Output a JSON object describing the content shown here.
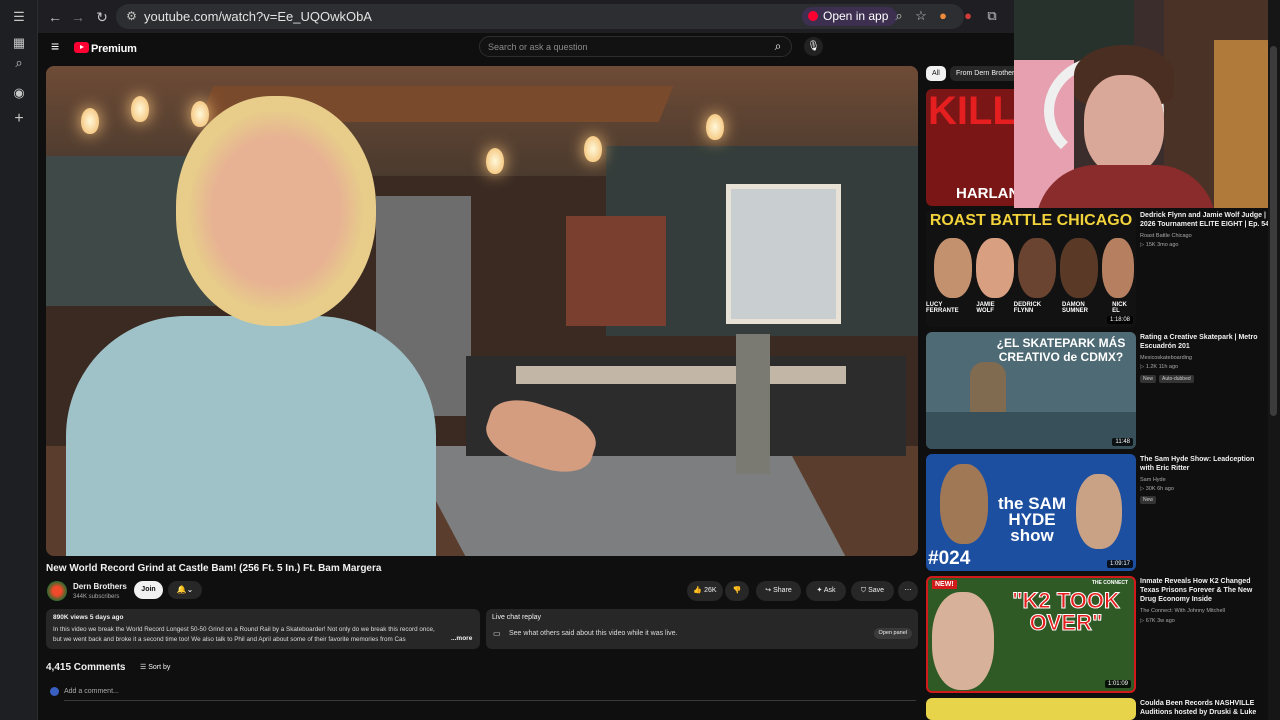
{
  "browser": {
    "url": "youtube.com/watch?v=Ee_UQOwkObA",
    "open_in_app": "Open in app"
  },
  "yt": {
    "brand": "Premium",
    "search_placeholder": "Search or ask a question"
  },
  "video": {
    "title": "New World Record Grind at Castle Bam! (256 Ft. 5 In.) Ft. Bam Margera",
    "channel": "Dern Brothers",
    "subscribers": "344K subscribers",
    "join_label": "Join",
    "likes": "26K",
    "share_label": "Share",
    "ask_label": "Ask",
    "save_label": "Save",
    "views_date": "890K views  5 days ago",
    "description_line1": "In this video we break the World Record Longest 50-50 Grind on a Round Rail by a Skateboarder! Not only do we break this record once,",
    "description_line2": "but we went back and broke it a second time too! We also talk to Phil and April about some of their favorite memories from Cas",
    "more_label": "...more"
  },
  "live_chat": {
    "title": "Live chat replay",
    "subtitle": "See what others said about this video while it was live.",
    "open_panel": "Open panel"
  },
  "comments": {
    "count_label": "4,415 Comments",
    "sort_label": "Sort by",
    "add_placeholder": "Add a comment..."
  },
  "chips": [
    "All",
    "From Dern Brothers"
  ],
  "recommendations": [
    {
      "thumb_text": "ROAST BATTLE CHICAGO",
      "title": "Dedrick Flynn and Jamie Wolf Judge | 2026 Tournament ELITE EIGHT | Ep. 54",
      "channel": "Roast Battle Chicago",
      "meta": "15K  3mo ago",
      "duration": "1:18:08",
      "names": [
        "LUCY FERRANTE",
        "JAMIE WOLF",
        "DEDRICK FLYNN",
        "DAMON SUMNER",
        "NICK EL"
      ]
    },
    {
      "thumb_text": "¿EL SKATEPARK MÁS CREATIVO de CDMX?",
      "title": "Rating a Creative Skatepark | Metro Escuadrón 201",
      "channel": "Mexicoskateboarding",
      "meta": "1.2K  11h ago",
      "duration": "11:48",
      "badges": [
        "New",
        "Auto-dubbed"
      ]
    },
    {
      "thumb_text": "the SAM HYDE show",
      "thumb_number": "#024",
      "title": "The Sam Hyde Show: Leadception with Eric Ritter",
      "channel": "Sam Hyde",
      "meta": "30K  6h ago",
      "duration": "1:09:17",
      "badges": [
        "New"
      ]
    },
    {
      "thumb_text": "\"K2 TOOK OVER\"",
      "thumb_tag": "NEW!",
      "thumb_brand": "THE CONNECT",
      "title": "Inmate Reveals How K2 Changed Texas Prisons Forever & The New Drug Economy Inside",
      "channel": "The Connect: With Johnny Mitchell",
      "meta": "67K  3w ago",
      "duration": "1:01:09"
    },
    {
      "title": "Coulda Been Records NASHVILLE Auditions hosted by Druski & Luke"
    }
  ],
  "top_thumb": {
    "text": "KILL",
    "caption": "HARLAN"
  },
  "colors": {
    "accent": "#ff0033",
    "bg": "#0f0f0f",
    "surface": "#272727"
  }
}
